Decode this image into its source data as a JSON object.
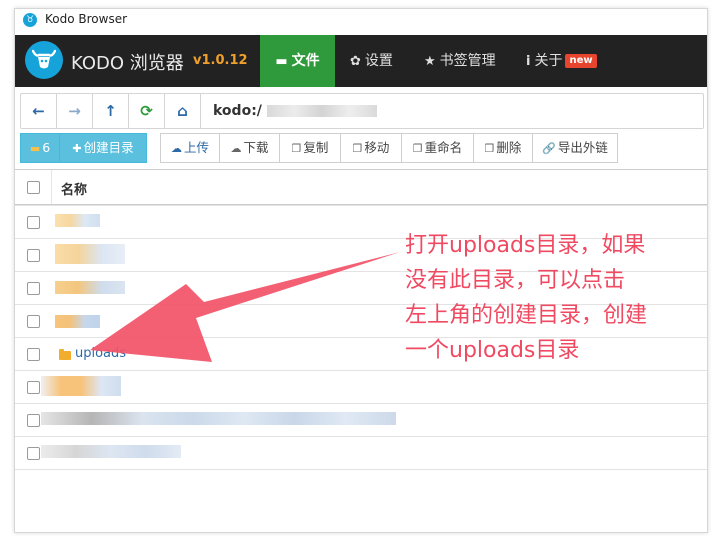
{
  "window": {
    "title": "Kodo Browser"
  },
  "navbar": {
    "brand": "KODO 浏览器",
    "version": "v1.0.12",
    "items": [
      {
        "label": "文件",
        "icon": "folder-icon",
        "active": true
      },
      {
        "label": "设置",
        "icon": "gear-icon"
      },
      {
        "label": "书签管理",
        "icon": "star-icon"
      },
      {
        "label": "关于",
        "icon": "info-icon",
        "badge": "new"
      }
    ]
  },
  "addressbar": {
    "buttons": [
      "back-icon",
      "forward-icon",
      "up-icon",
      "refresh-icon",
      "home-icon"
    ],
    "address": "kodo:/"
  },
  "toolbar": {
    "count": "6",
    "create_dir": "创建目录",
    "upload": "上传",
    "download": "下载",
    "copy": "复制",
    "move": "移动",
    "rename": "重命名",
    "delete": "删除",
    "export_link": "导出外链"
  },
  "table": {
    "header": "名称",
    "uploads_row": "uploads"
  },
  "annotation": {
    "lines": [
      "打开uploads目录，如果",
      "没有此目录，可以点击",
      "左上角的创建目录，创建",
      "一个uploads目录"
    ],
    "color": "#f04a62"
  }
}
